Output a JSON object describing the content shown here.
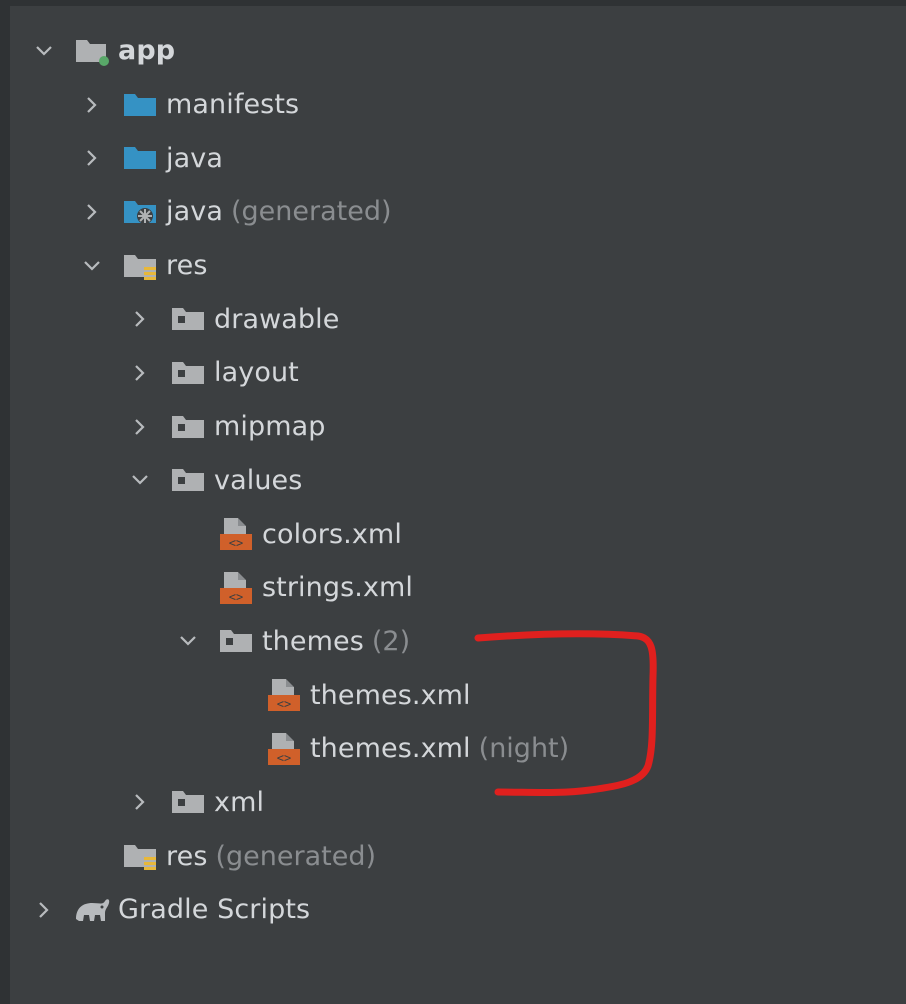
{
  "tree": {
    "app": {
      "label": "app"
    },
    "manifests": {
      "label": "manifests"
    },
    "java": {
      "label": "java"
    },
    "java_generated": {
      "label": "java",
      "suffix": "(generated)"
    },
    "res": {
      "label": "res"
    },
    "drawable": {
      "label": "drawable"
    },
    "layout": {
      "label": "layout"
    },
    "mipmap": {
      "label": "mipmap"
    },
    "values": {
      "label": "values"
    },
    "colors": {
      "label": "colors.xml"
    },
    "strings": {
      "label": "strings.xml"
    },
    "themes": {
      "label": "themes",
      "suffix": "(2)"
    },
    "themes_xml": {
      "label": "themes.xml"
    },
    "themes_xml_night": {
      "label": "themes.xml",
      "suffix": "(night)"
    },
    "xml": {
      "label": "xml"
    },
    "res_generated": {
      "label": "res",
      "suffix": "(generated)"
    },
    "gradle_scripts": {
      "label": "Gradle Scripts"
    }
  },
  "colors": {
    "background": "#3c3f41",
    "folder_blue": "#3592c4",
    "folder_grey": "#afb1b3",
    "xml_orange": "#d0602a",
    "annotation_red": "#e0201e",
    "module_dot": "#59a869"
  }
}
